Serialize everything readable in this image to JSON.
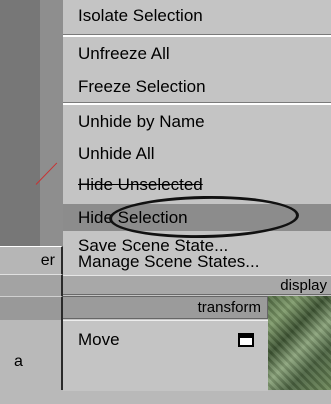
{
  "menu": {
    "items": [
      {
        "label": "Isolate Selection",
        "state": "normal"
      },
      {
        "label": "Unfreeze All",
        "state": "normal"
      },
      {
        "label": "Freeze Selection",
        "state": "normal"
      },
      {
        "label": "Unhide by Name",
        "state": "normal"
      },
      {
        "label": "Unhide All",
        "state": "normal"
      },
      {
        "label": "Hide Unselected",
        "state": "normal"
      },
      {
        "label": "Hide Selection",
        "state": "highlighted"
      },
      {
        "label": "Save Scene State...",
        "state": "normal"
      },
      {
        "label": "Manage Scene States...",
        "state": "normal"
      }
    ]
  },
  "left": {
    "label_top": "er",
    "label_bottom": "a"
  },
  "section": {
    "display_label": "display",
    "transform_label": "transform"
  },
  "transform_menu": {
    "move_label": "Move",
    "option_icon": "option-box-icon"
  },
  "colors": {
    "menu_bg": "#c4c4c4",
    "highlight_bg": "#8c8c8c",
    "annotation": "#111111",
    "axis_red": "#c83232"
  }
}
